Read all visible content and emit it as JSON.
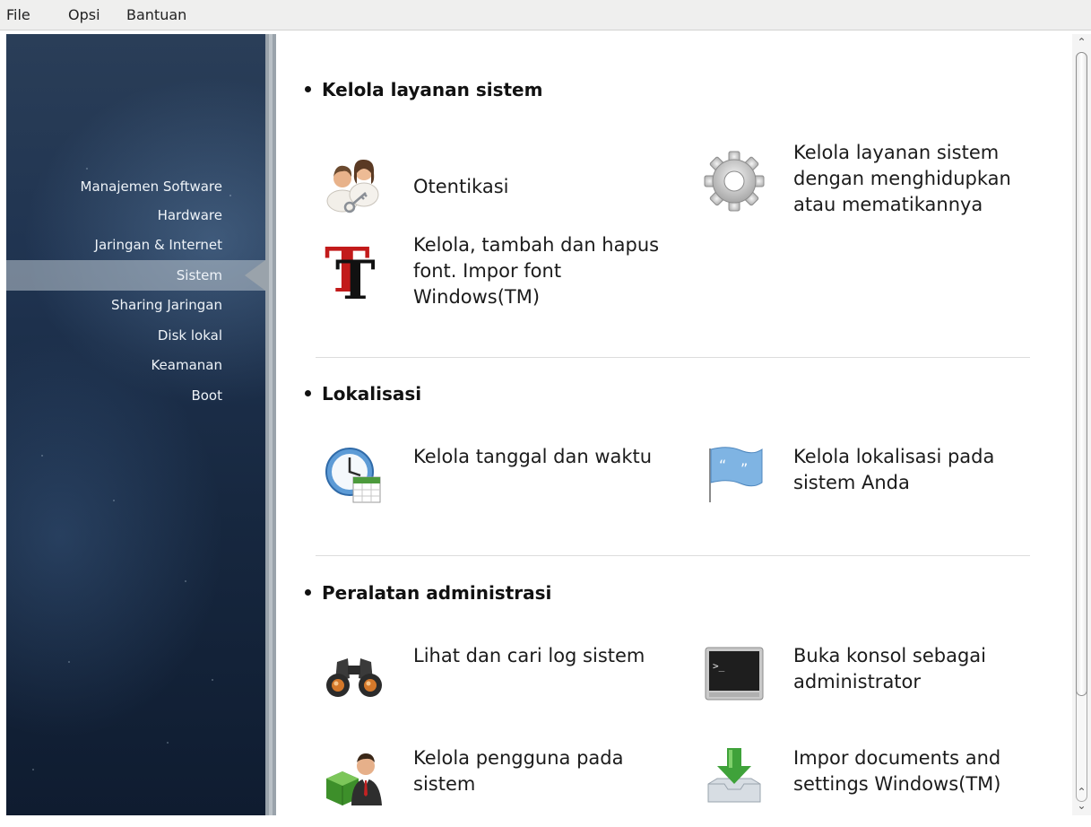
{
  "menubar": {
    "items": [
      {
        "label": "File"
      },
      {
        "label": "Opsi"
      },
      {
        "label": "Bantuan"
      }
    ]
  },
  "sidebar": {
    "items": [
      {
        "label": "Manajemen Software"
      },
      {
        "label": "Hardware"
      },
      {
        "label": "Jaringan & Internet"
      },
      {
        "label": "Sistem",
        "selected": true
      },
      {
        "label": "Sharing Jaringan"
      },
      {
        "label": "Disk lokal"
      },
      {
        "label": "Keamanan"
      },
      {
        "label": "Boot"
      }
    ]
  },
  "sections": [
    {
      "title": "Kelola layanan sistem",
      "items": [
        {
          "label": "Otentikasi",
          "icon": "users-key-icon"
        },
        {
          "label": "Kelola layanan sistem dengan menghidupkan atau mematikannya",
          "icon": "gear-icon"
        },
        {
          "label": "Kelola, tambah dan hapus font. Impor font Windows(TM)",
          "icon": "font-icon"
        }
      ]
    },
    {
      "title": "Lokalisasi",
      "items": [
        {
          "label": "Kelola tanggal dan waktu",
          "icon": "clock-calendar-icon"
        },
        {
          "label": "Kelola lokalisasi pada sistem Anda",
          "icon": "flag-icon"
        }
      ]
    },
    {
      "title": "Peralatan administrasi",
      "items": [
        {
          "label": "Lihat dan cari log sistem",
          "icon": "binoculars-icon"
        },
        {
          "label": "Buka konsol sebagai administrator",
          "icon": "terminal-icon"
        },
        {
          "label": "Kelola pengguna pada sistem",
          "icon": "user-manage-icon"
        },
        {
          "label": "Impor documents and settings Windows(TM)",
          "icon": "download-tray-icon"
        }
      ]
    }
  ],
  "colors": {
    "sidebar_bg": "#1f3350",
    "sidebar_text": "#eef3f8",
    "accent_strip": "#9aa3ab"
  }
}
